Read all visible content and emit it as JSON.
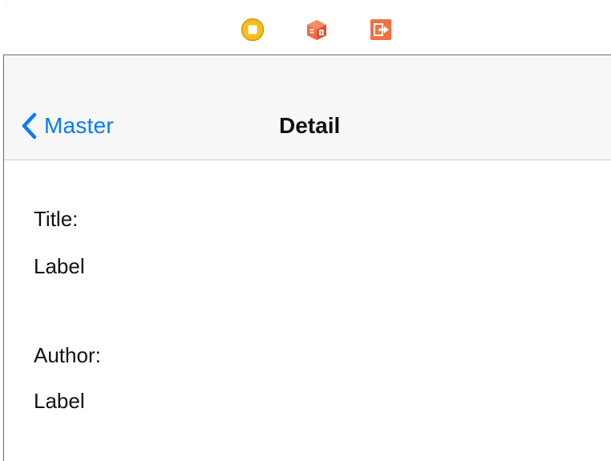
{
  "scene_dock": {
    "icons": [
      {
        "name": "view-controller-icon",
        "color": "#f2b51b"
      },
      {
        "name": "first-responder-icon",
        "color": "#ef6d47"
      },
      {
        "name": "exit-icon",
        "color": "#f07040"
      }
    ]
  },
  "navbar": {
    "back_label": "Master",
    "title": "Detail",
    "tint_color": "#0a7aff"
  },
  "content": {
    "title_caption": "Title:",
    "title_value": "Label",
    "author_caption": "Author:",
    "author_value": "Label"
  }
}
